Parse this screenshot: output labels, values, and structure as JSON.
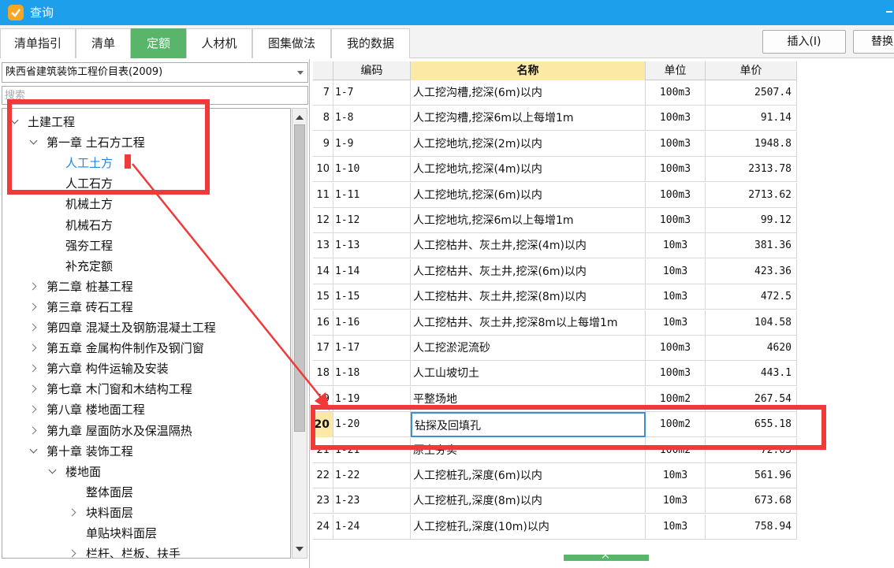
{
  "window": {
    "title": "查询"
  },
  "tabs": [
    {
      "label": "清单指引"
    },
    {
      "label": "清单"
    },
    {
      "label": "定额"
    },
    {
      "label": "人材机"
    },
    {
      "label": "图集做法"
    },
    {
      "label": "我的数据"
    }
  ],
  "toolbar": {
    "insert_label": "插入(I)",
    "replace_label": "替换"
  },
  "library": {
    "selected": "陕西省建筑装饰工程价目表(2009)"
  },
  "search": {
    "placeholder": "搜索"
  },
  "tree": [
    {
      "label": "土建工程",
      "level": 0,
      "expand": "down"
    },
    {
      "label": "第一章 土石方工程",
      "level": 1,
      "expand": "down"
    },
    {
      "label": "人工土方",
      "level": 2,
      "expand": "none",
      "selected": true
    },
    {
      "label": "人工石方",
      "level": 2,
      "expand": "none"
    },
    {
      "label": "机械土方",
      "level": 2,
      "expand": "none"
    },
    {
      "label": "机械石方",
      "level": 2,
      "expand": "none"
    },
    {
      "label": "强夯工程",
      "level": 2,
      "expand": "none"
    },
    {
      "label": "补充定额",
      "level": 2,
      "expand": "none"
    },
    {
      "label": "第二章 桩基工程",
      "level": 1,
      "expand": "right"
    },
    {
      "label": "第三章 砖石工程",
      "level": 1,
      "expand": "right"
    },
    {
      "label": "第四章 混凝土及钢筋混凝土工程",
      "level": 1,
      "expand": "right"
    },
    {
      "label": "第五章 金属构件制作及钢门窗",
      "level": 1,
      "expand": "right"
    },
    {
      "label": "第六章 构件运输及安装",
      "level": 1,
      "expand": "right"
    },
    {
      "label": "第七章 木门窗和木结构工程",
      "level": 1,
      "expand": "right"
    },
    {
      "label": "第八章 楼地面工程",
      "level": 1,
      "expand": "right"
    },
    {
      "label": "第九章 屋面防水及保温隔热",
      "level": 1,
      "expand": "right"
    },
    {
      "label": "第十章 装饰工程",
      "level": 1,
      "expand": "down"
    },
    {
      "label": "楼地面",
      "level": 2,
      "expand": "down"
    },
    {
      "label": "整体面层",
      "level": 3,
      "expand": "none"
    },
    {
      "label": "块料面层",
      "level": 3,
      "expand": "right"
    },
    {
      "label": "单贴块料面层",
      "level": 3,
      "expand": "none"
    },
    {
      "label": "栏杆、栏板、扶手",
      "level": 3,
      "expand": "right"
    }
  ],
  "grid": {
    "columns": {
      "code": "编码",
      "name": "名称",
      "unit": "单位",
      "price": "单价"
    },
    "rows": [
      {
        "idx": "7",
        "code": "1-7",
        "name": "人工挖沟槽,挖深(6m)以内",
        "unit": "100m3",
        "price": "2507.4"
      },
      {
        "idx": "8",
        "code": "1-8",
        "name": "人工挖沟槽,挖深6m以上每增1m",
        "unit": "100m3",
        "price": "91.14"
      },
      {
        "idx": "9",
        "code": "1-9",
        "name": "人工挖地坑,挖深(2m)以内",
        "unit": "100m3",
        "price": "1948.8"
      },
      {
        "idx": "10",
        "code": "1-10",
        "name": "人工挖地坑,挖深(4m)以内",
        "unit": "100m3",
        "price": "2313.78"
      },
      {
        "idx": "11",
        "code": "1-11",
        "name": "人工挖地坑,挖深(6m)以内",
        "unit": "100m3",
        "price": "2713.62"
      },
      {
        "idx": "12",
        "code": "1-12",
        "name": "人工挖地坑,挖深6m以上每增1m",
        "unit": "100m3",
        "price": "99.12"
      },
      {
        "idx": "13",
        "code": "1-13",
        "name": "人工挖枯井、灰土井,挖深(4m)以内",
        "unit": "10m3",
        "price": "381.36"
      },
      {
        "idx": "14",
        "code": "1-14",
        "name": "人工挖枯井、灰土井,挖深(6m)以内",
        "unit": "10m3",
        "price": "423.36"
      },
      {
        "idx": "15",
        "code": "1-15",
        "name": "人工挖枯井、灰土井,挖深(8m)以内",
        "unit": "10m3",
        "price": "472.5"
      },
      {
        "idx": "16",
        "code": "1-16",
        "name": "人工挖枯井、灰土井,挖深8m以上每增1m",
        "unit": "10m3",
        "price": "104.58"
      },
      {
        "idx": "17",
        "code": "1-17",
        "name": "人工挖淤泥流砂",
        "unit": "100m3",
        "price": "4620"
      },
      {
        "idx": "18",
        "code": "1-18",
        "name": "人工山坡切土",
        "unit": "100m3",
        "price": "443.1"
      },
      {
        "idx": "19",
        "code": "1-19",
        "name": "平整场地",
        "unit": "100m2",
        "price": "267.54"
      },
      {
        "idx": "20",
        "code": "1-20",
        "name": "钻探及回填孔",
        "unit": "100m2",
        "price": "655.18",
        "current": true
      },
      {
        "idx": "21",
        "code": "1-21",
        "name": "原土夯实",
        "unit": "100m2",
        "price": "72.03"
      },
      {
        "idx": "22",
        "code": "1-22",
        "name": "人工挖桩孔,深度(6m)以内",
        "unit": "10m3",
        "price": "561.96"
      },
      {
        "idx": "23",
        "code": "1-23",
        "name": "人工挖桩孔,深度(8m)以内",
        "unit": "10m3",
        "price": "673.68"
      },
      {
        "idx": "24",
        "code": "1-24",
        "name": "人工挖桩孔,深度(10m)以内",
        "unit": "10m3",
        "price": "758.94"
      }
    ]
  },
  "colors": {
    "accent": "#1e9fec",
    "active_tab": "#58b56a",
    "annotation": "#f03a3a",
    "header_highlight": "#fce9a6"
  }
}
